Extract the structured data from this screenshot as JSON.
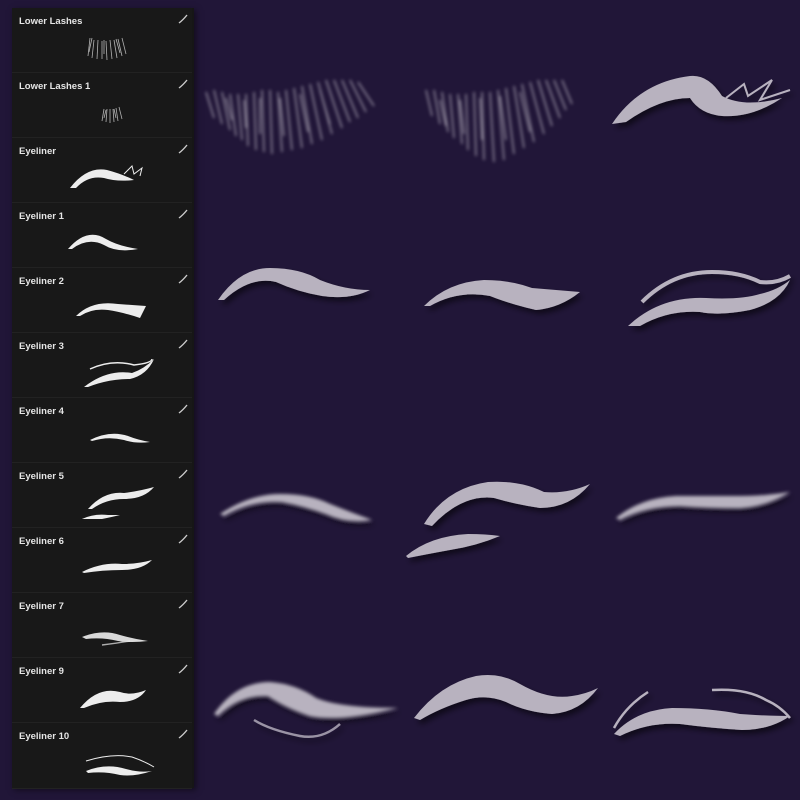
{
  "brushes": [
    {
      "label": "Lower Lashes",
      "preview": "lashes-wide"
    },
    {
      "label": "Lower Lashes 1",
      "preview": "lashes-small"
    },
    {
      "label": "Eyeliner",
      "preview": "wing-feather"
    },
    {
      "label": "Eyeliner 1",
      "preview": "wing-arc"
    },
    {
      "label": "Eyeliner 2",
      "preview": "wing-flat"
    },
    {
      "label": "Eyeliner 3",
      "preview": "wing-double"
    },
    {
      "label": "Eyeliner 4",
      "preview": "wing-thin"
    },
    {
      "label": "Eyeliner 5",
      "preview": "wing-split"
    },
    {
      "label": "Eyeliner 6",
      "preview": "wing-thin"
    },
    {
      "label": "Eyeliner 7",
      "preview": "wing-soft"
    },
    {
      "label": "Eyeliner 9",
      "preview": "wing-hook"
    },
    {
      "label": "Eyeliner 10",
      "preview": "wing-line"
    }
  ],
  "colors": {
    "canvas_bg": "#211638",
    "panel_bg": "#181818",
    "stroke_color": "#b8b2bf",
    "panel_text": "#e6e6e6"
  }
}
